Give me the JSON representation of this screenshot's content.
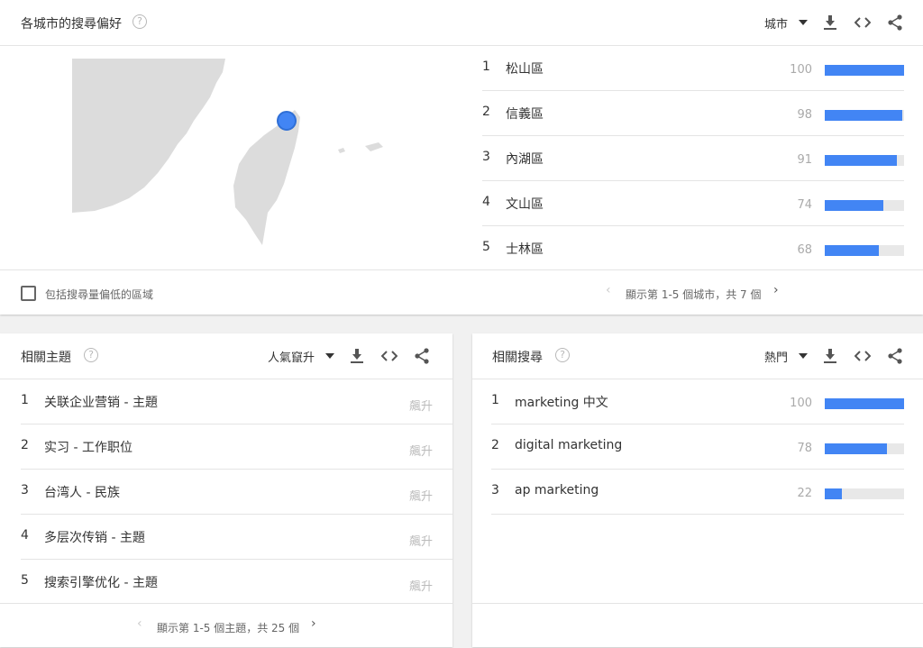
{
  "region_panel": {
    "title": "各城市的搜尋偏好",
    "help": "?",
    "selector": "城市",
    "rows": [
      {
        "rank": "1",
        "label": "松山區",
        "value": "100",
        "pct": 100
      },
      {
        "rank": "2",
        "label": "信義區",
        "value": "98",
        "pct": 98
      },
      {
        "rank": "3",
        "label": "內湖區",
        "value": "91",
        "pct": 91
      },
      {
        "rank": "4",
        "label": "文山區",
        "value": "74",
        "pct": 74
      },
      {
        "rank": "5",
        "label": "士林區",
        "value": "68",
        "pct": 68
      }
    ],
    "checkbox_label": "包括搜尋量偏低的區域",
    "pagination": "顯示第 1-5 個城市，共 7 個",
    "prev": "‹",
    "next": "›"
  },
  "topics_panel": {
    "title": "相關主題",
    "help": "?",
    "selector": "人氣竄升",
    "rows": [
      {
        "rank": "1",
        "label": "关联企业营销 - 主題",
        "value": "飆升"
      },
      {
        "rank": "2",
        "label": "实习 - 工作职位",
        "value": "飆升"
      },
      {
        "rank": "3",
        "label": "台湾人 - 民族",
        "value": "飆升"
      },
      {
        "rank": "4",
        "label": "多层次传销 - 主題",
        "value": "飆升"
      },
      {
        "rank": "5",
        "label": "搜索引擎优化 - 主題",
        "value": "飆升"
      }
    ],
    "pagination": "顯示第 1-5 個主題，共 25 個",
    "prev": "‹",
    "next": "›"
  },
  "queries_panel": {
    "title": "相關搜尋",
    "help": "?",
    "selector": "熱門",
    "rows": [
      {
        "rank": "1",
        "label": "marketing 中文",
        "value": "100",
        "pct": 100
      },
      {
        "rank": "2",
        "label": "digital marketing",
        "value": "78",
        "pct": 78
      },
      {
        "rank": "3",
        "label": "ap marketing",
        "value": "22",
        "pct": 22
      }
    ]
  },
  "colors": {
    "bar": "#4285f4",
    "track": "#e8e8e8",
    "map_land": "#dcdcdc",
    "marker": "#4285f4"
  }
}
